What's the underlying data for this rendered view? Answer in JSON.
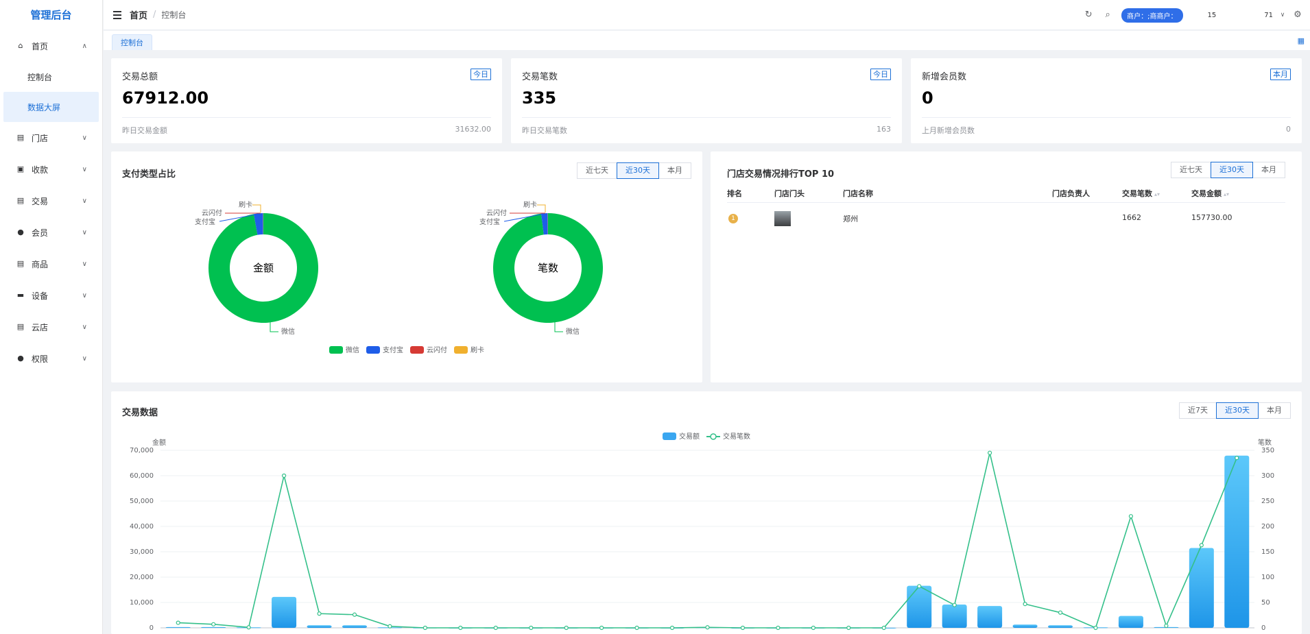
{
  "app": {
    "title": "管理后台"
  },
  "sidebar": {
    "items": [
      {
        "label": "首页",
        "icon": "home-icon",
        "expanded": true
      },
      {
        "label": "门店",
        "icon": "store-icon"
      },
      {
        "label": "收款",
        "icon": "receipt-icon"
      },
      {
        "label": "交易",
        "icon": "trade-icon"
      },
      {
        "label": "会员",
        "icon": "user-icon"
      },
      {
        "label": "商品",
        "icon": "goods-icon"
      },
      {
        "label": "设备",
        "icon": "device-icon"
      },
      {
        "label": "云店",
        "icon": "cloud-store-icon"
      },
      {
        "label": "权限",
        "icon": "permission-icon"
      }
    ],
    "sub_items": [
      {
        "label": "控制台",
        "active": false
      },
      {
        "label": "数据大屏",
        "active": true
      }
    ]
  },
  "header": {
    "breadcrumb_home": "首页",
    "breadcrumb_separator": "/",
    "breadcrumb_current": "控制台",
    "merchant_label": "商户：;商商户：",
    "num_left": "15",
    "num_right": "71"
  },
  "tabs": {
    "active": "控制台"
  },
  "stats": [
    {
      "title": "交易总额",
      "badge": "今日",
      "value": "67912.00",
      "foot_label": "昨日交易金额",
      "foot_value": "31632.00"
    },
    {
      "title": "交易笔数",
      "badge": "今日",
      "value": "335",
      "foot_label": "昨日交易笔数",
      "foot_value": "163"
    },
    {
      "title": "新增会员数",
      "badge": "本月",
      "value": "0",
      "foot_label": "上月新增会员数",
      "foot_value": "0"
    }
  ],
  "pay_type": {
    "title": "支付类型占比",
    "ranges": [
      "近七天",
      "近30天",
      "本月"
    ],
    "selected_range": "近30天",
    "donut_amount_label": "金额",
    "donut_count_label": "笔数",
    "legend": [
      "微信",
      "支付宝",
      "云闪付",
      "刷卡"
    ],
    "colors": {
      "wechat": "#00c050",
      "alipay": "#1f5de8",
      "unionpay": "#d63a34",
      "card": "#f0b02e"
    }
  },
  "ranking": {
    "title": "门店交易情况排行TOP 10",
    "ranges": [
      "近七天",
      "近30天",
      "本月"
    ],
    "selected_range": "近30天",
    "columns": [
      "排名",
      "门店门头",
      "门店名称",
      "门店负责人",
      "交易笔数",
      "交易金额"
    ],
    "rows": [
      {
        "rank": "1",
        "name": "郑州",
        "manager": "",
        "count": "1662",
        "amount": "157730.00"
      }
    ]
  },
  "trade_chart": {
    "title": "交易数据",
    "ranges": [
      "近7天",
      "近30天",
      "本月"
    ],
    "selected_range": "近30天"
  },
  "chart_data": [
    {
      "type": "pie",
      "title": "金额",
      "categories": [
        "微信",
        "支付宝",
        "云闪付",
        "刷卡"
      ],
      "values": [
        97.2,
        2.7,
        0.05,
        0.05
      ]
    },
    {
      "type": "pie",
      "title": "笔数",
      "categories": [
        "微信",
        "支付宝",
        "云闪付",
        "刷卡"
      ],
      "values": [
        98.0,
        1.9,
        0.05,
        0.05
      ]
    },
    {
      "type": "bar",
      "title": "",
      "legend": [
        "交易额",
        "交易笔数"
      ],
      "ylabel": "金额",
      "y2label": "笔数",
      "ylim": [
        0,
        70000
      ],
      "y2lim": [
        0,
        350
      ],
      "ticks": [
        "0",
        "10,000",
        "20,000",
        "30,000",
        "40,000",
        "50,000",
        "60,000",
        "70,000"
      ],
      "ticks2": [
        "0",
        "50",
        "100",
        "150",
        "200",
        "250",
        "300",
        "350"
      ],
      "series": [
        {
          "name": "交易额",
          "type": "bar",
          "values": [
            300,
            300,
            200,
            12200,
            1000,
            1000,
            200,
            100,
            50,
            50,
            50,
            50,
            50,
            50,
            50,
            200,
            50,
            50,
            50,
            50,
            50,
            16600,
            9200,
            8600,
            1300,
            1000,
            200,
            4700,
            300,
            31500,
            67900
          ]
        },
        {
          "name": "交易笔数",
          "type": "line",
          "values": [
            10,
            7,
            1,
            300,
            28,
            26,
            3,
            0,
            0,
            0,
            0,
            0,
            0,
            0,
            0,
            1,
            0,
            0,
            0,
            0,
            0,
            82,
            45,
            345,
            47,
            30,
            0,
            220,
            4,
            163,
            335
          ]
        }
      ]
    }
  ]
}
